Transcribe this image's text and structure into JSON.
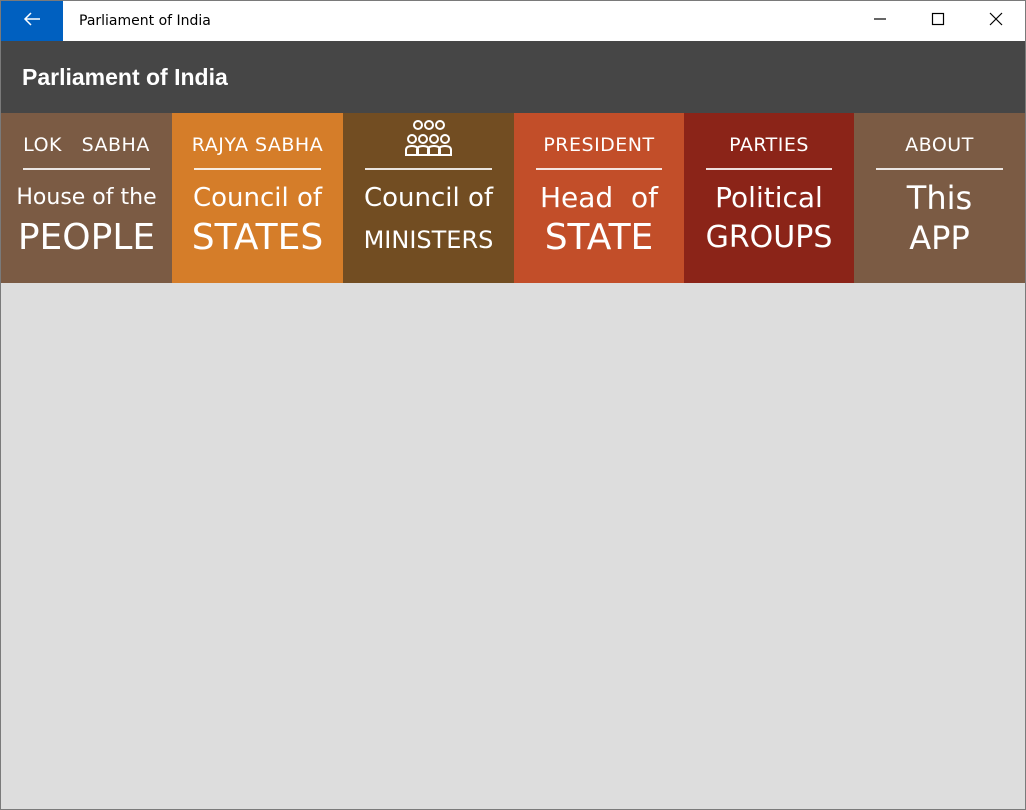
{
  "window": {
    "title": "Parliament of India",
    "back_icon": "arrow-left-icon",
    "controls": [
      "minimize-icon",
      "maximize-icon",
      "close-icon"
    ],
    "colors": {
      "back_button": "#0060c0",
      "titlebar": "#ffffff"
    }
  },
  "header": {
    "title": "Parliament of India",
    "color": "#464646"
  },
  "tiles": [
    {
      "id": "lok-sabha",
      "top": "LOK   SABHA",
      "line1": "House of the",
      "line2": "PEOPLE",
      "color": "#7b5b44"
    },
    {
      "id": "rajya-sabha",
      "top": "RAJYA SABHA",
      "line1": "Council of",
      "line2": "STATES",
      "color": "#d57d29"
    },
    {
      "id": "ministers",
      "top_icon": "people-group-icon",
      "line1": "Council of",
      "line2": "MINISTERS",
      "color": "#724d22"
    },
    {
      "id": "president",
      "top": "PRESIDENT",
      "line1": "Head  of",
      "line2": "STATE",
      "color": "#c24e29"
    },
    {
      "id": "parties",
      "top": "PARTIES",
      "line1": "Political",
      "line2": "GROUPS",
      "color": "#8b2418"
    },
    {
      "id": "about",
      "top": "ABOUT",
      "line1": "This",
      "line2": "APP",
      "color": "#7b5b44"
    }
  ],
  "content": {
    "background": "#dddddd"
  }
}
